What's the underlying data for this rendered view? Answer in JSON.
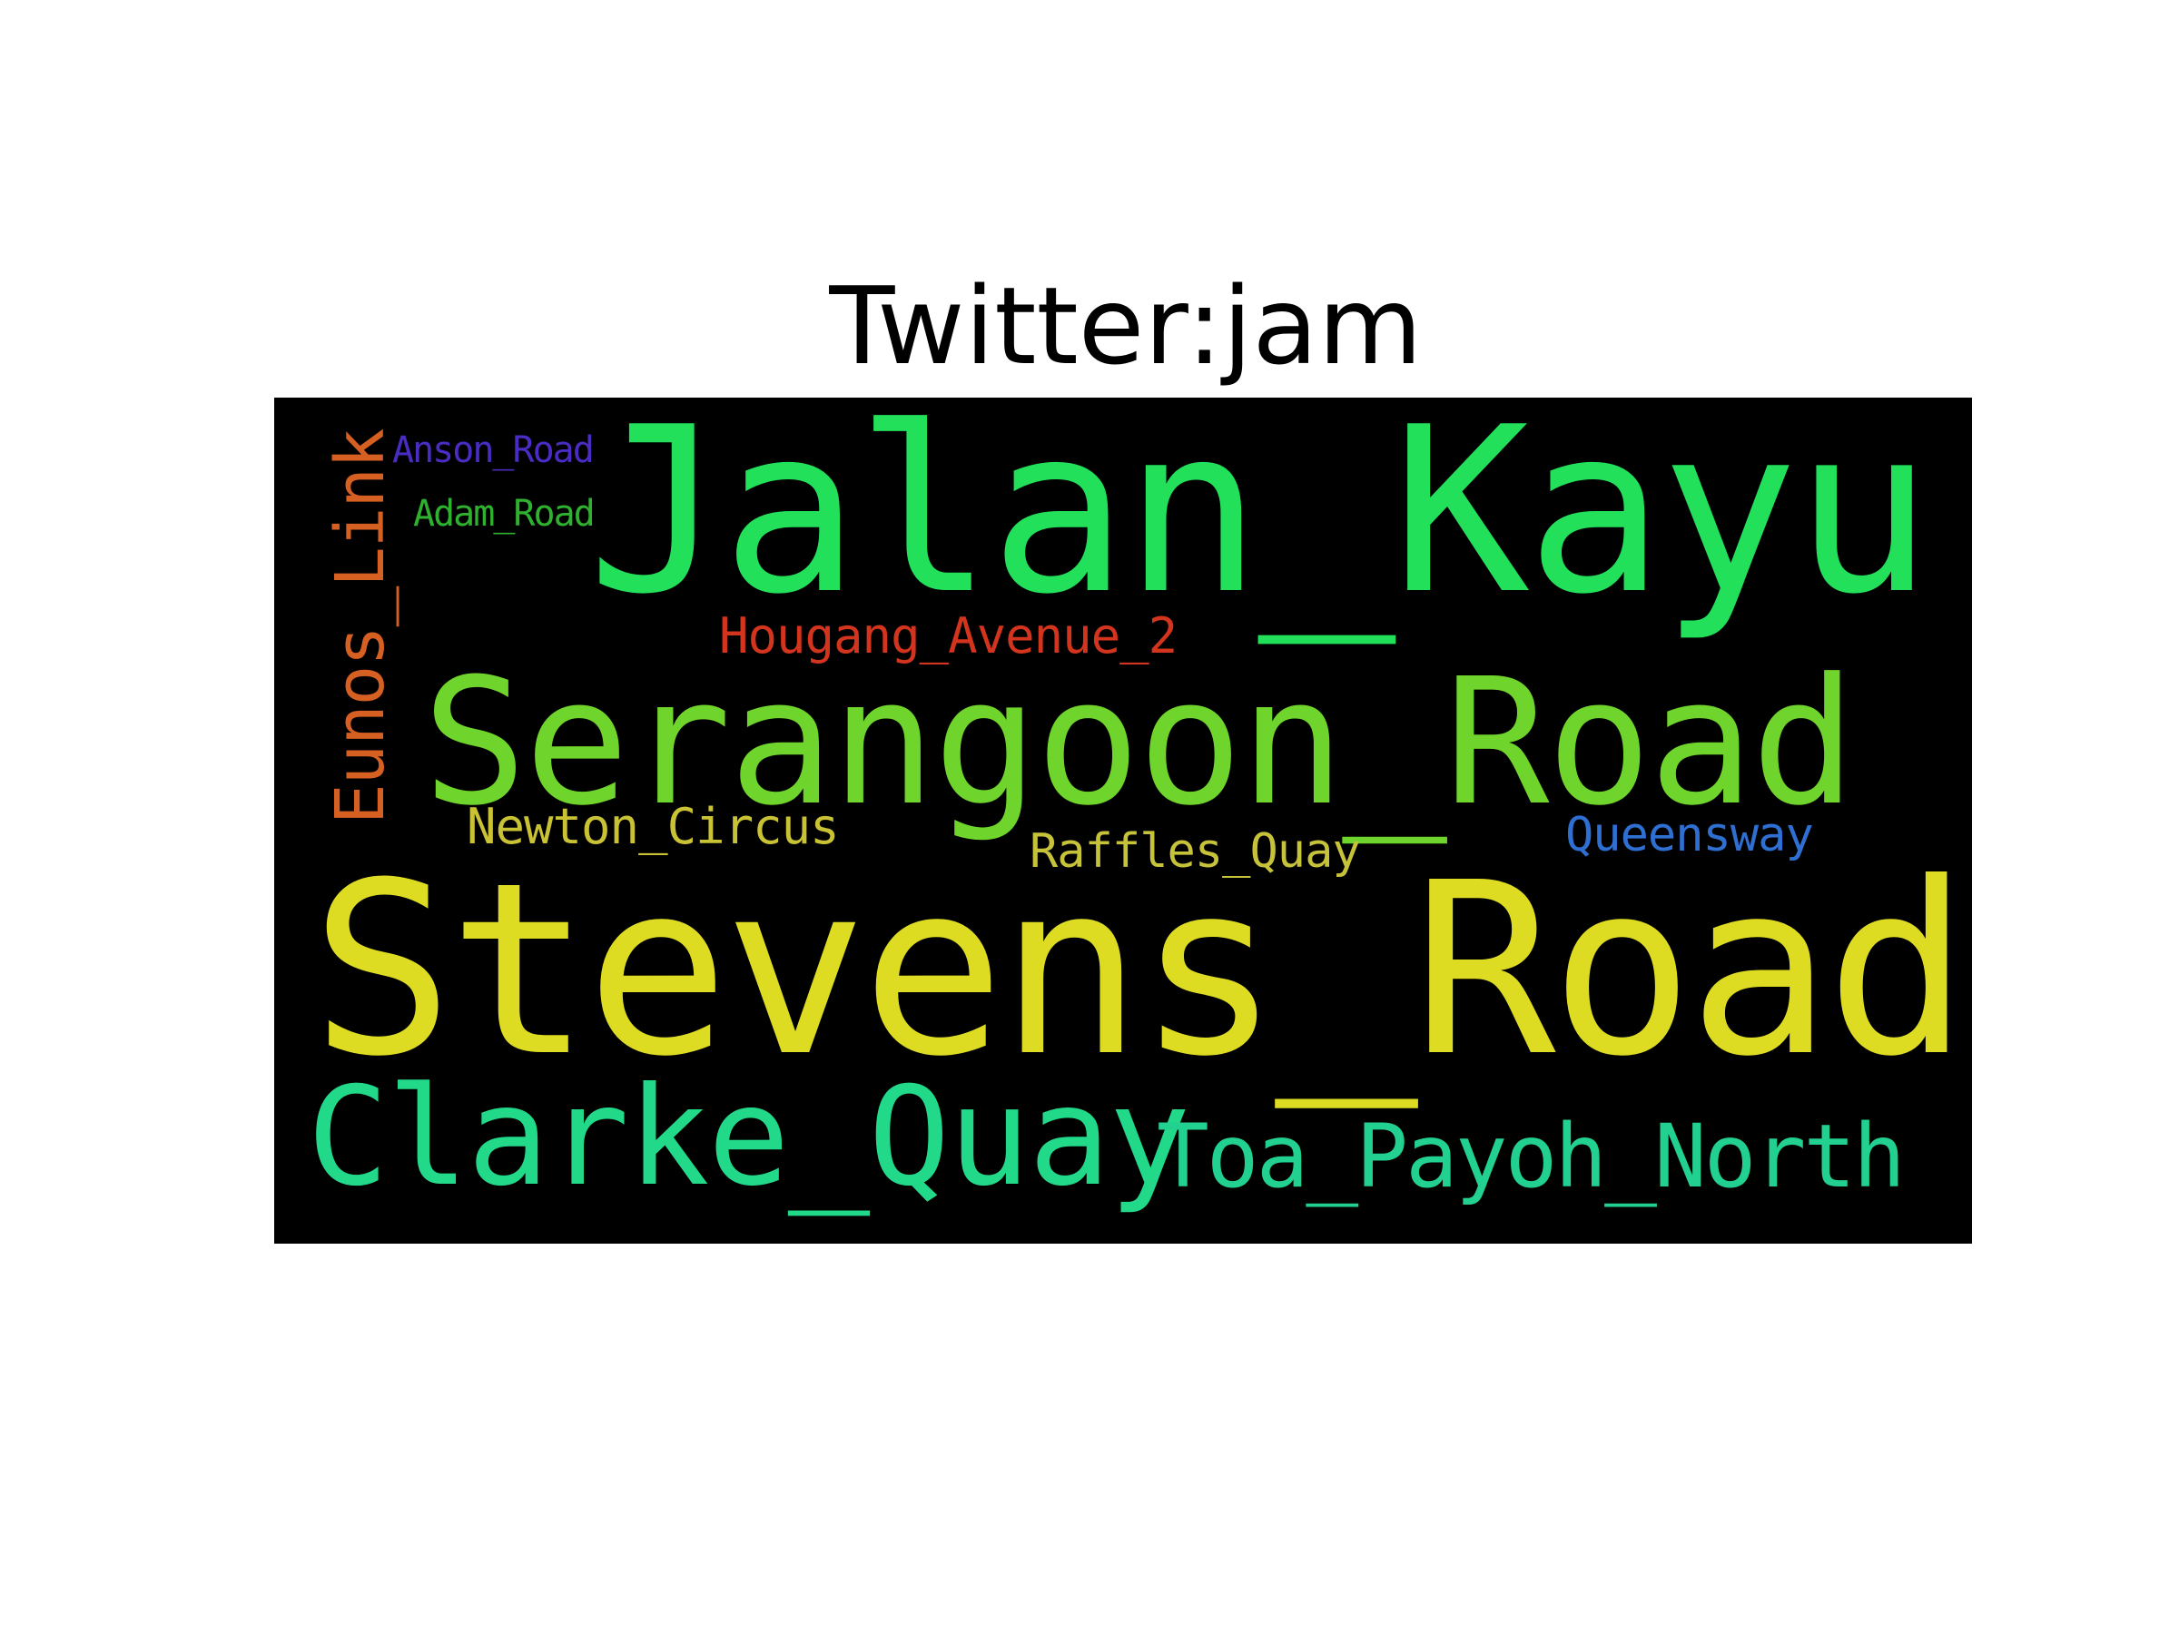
{
  "title": "Twitter:jam",
  "cloud": {
    "background": "#000000",
    "words": {
      "jalan_kayu": {
        "text": "Jalan_Kayu",
        "color": "#22e05a"
      },
      "stevens_road": {
        "text": "Stevens_Road",
        "color": "#dedc22"
      },
      "serangoon_road": {
        "text": "Serangoon_Road",
        "color": "#6fd42c"
      },
      "clarke_quay": {
        "text": "Clarke_Quay",
        "color": "#22d98a"
      },
      "toa_payoh_north": {
        "text": "Toa_Payoh_North",
        "color": "#22d08f"
      },
      "hougang_avenue_2": {
        "text": "Hougang_Avenue_2",
        "color": "#d3341d"
      },
      "newton_circus": {
        "text": "Newton_Circus",
        "color": "#c9c234"
      },
      "raffles_quay": {
        "text": "Raffles_Quay",
        "color": "#c6c23a"
      },
      "queensway": {
        "text": "Queensway",
        "color": "#2e6fd1"
      },
      "anson_road": {
        "text": "Anson_Road",
        "color": "#4b2cc3"
      },
      "adam_road": {
        "text": "Adam_Road",
        "color": "#2fb12f"
      },
      "eunos_link": {
        "text": "Eunos_Link",
        "color": "#d65f22"
      }
    }
  }
}
